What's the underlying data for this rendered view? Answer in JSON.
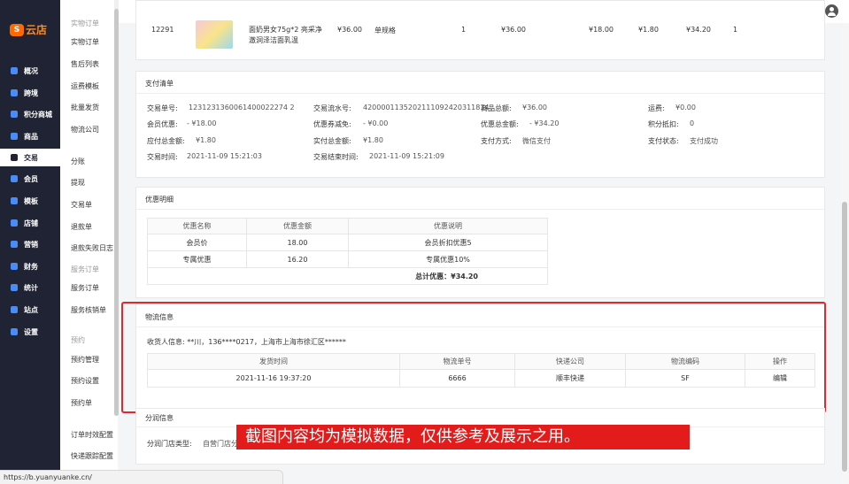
{
  "logo": {
    "mark": "S",
    "text": "云店"
  },
  "nav": [
    {
      "label": "概况",
      "active": false
    },
    {
      "label": "跨境",
      "active": false
    },
    {
      "label": "积分商城",
      "active": false
    },
    {
      "label": "商品",
      "active": false
    },
    {
      "label": "交易",
      "active": true
    },
    {
      "label": "会员",
      "active": false
    },
    {
      "label": "模板",
      "active": false
    },
    {
      "label": "店铺",
      "active": false
    },
    {
      "label": "营销",
      "active": false
    },
    {
      "label": "财务",
      "active": false
    },
    {
      "label": "统计",
      "active": false
    },
    {
      "label": "站点",
      "active": false
    },
    {
      "label": "设置",
      "active": false
    }
  ],
  "submenu": [
    {
      "label": "实物订单",
      "group": true
    },
    {
      "label": "实物订单",
      "group": false
    },
    {
      "label": "售后列表",
      "group": false
    },
    {
      "label": "运费模板",
      "group": false
    },
    {
      "label": "批量发货",
      "group": false
    },
    {
      "label": "物流公司",
      "group": false
    },
    {
      "label": "分账",
      "group": false
    },
    {
      "label": "提现",
      "group": false
    },
    {
      "label": "交易单",
      "group": false
    },
    {
      "label": "退款单",
      "group": false
    },
    {
      "label": "退款失败日志",
      "group": false
    },
    {
      "label": "服务订单",
      "group": true
    },
    {
      "label": "服务订单",
      "group": false
    },
    {
      "label": "服务核销单",
      "group": false
    },
    {
      "label": "预约",
      "group": true
    },
    {
      "label": "预约管理",
      "group": false
    },
    {
      "label": "预约设置",
      "group": false
    },
    {
      "label": "预约单",
      "group": false
    },
    {
      "label": "订单时效配置",
      "group": false
    },
    {
      "label": "快递跟踪配置",
      "group": false
    }
  ],
  "product_row": {
    "id": "12291",
    "name_line1": "面奶男女75g*2 亮采净",
    "name_line2": "澈洞泽洁面乳温",
    "price": "¥36.00",
    "spec": "单规格",
    "qty": "1",
    "total": "¥36.00",
    "paid": "¥18.00",
    "discount": "¥1.80",
    "final": "¥34.20",
    "num": "1"
  },
  "payment": {
    "title": "支付清单",
    "fields": [
      {
        "label": "交易单号:",
        "value": "1231231360061400022274 2"
      },
      {
        "label": "交易流水号:",
        "value": "4200001135202111092420311834"
      },
      {
        "label": "商品总额:",
        "value": "¥36.00"
      },
      {
        "label": "运费:",
        "value": "¥0.00"
      },
      {
        "label": "会员优惠:",
        "value": "- ¥18.00"
      },
      {
        "label": "优惠券减免:",
        "value": "- ¥0.00"
      },
      {
        "label": "优惠总金额:",
        "value": "- ¥34.20"
      },
      {
        "label": "积分抵扣:",
        "value": "0"
      },
      {
        "label": "应付总金额:",
        "value": "¥1.80"
      },
      {
        "label": "实付总金额:",
        "value": "¥1.80"
      },
      {
        "label": "支付方式:",
        "value": "微信支付"
      },
      {
        "label": "支付状态:",
        "value": "支付成功"
      },
      {
        "label": "交易时间:",
        "value": "2021-11-09 15:21:03"
      },
      {
        "label": "交易结束时间:",
        "value": "2021-11-09 15:21:09"
      }
    ]
  },
  "discount_detail": {
    "title": "优惠明细",
    "headers": [
      "优惠名称",
      "优惠金额",
      "优惠说明"
    ],
    "rows": [
      [
        "会员价",
        "18.00",
        "会员折扣优惠5"
      ],
      [
        "专属优惠",
        "16.20",
        "专属优惠10%"
      ]
    ],
    "total": "总计优惠：¥34.20"
  },
  "logistics": {
    "title": "物流信息",
    "receiver": "收货人信息: **川，136****0217，上海市上海市徐汇区******",
    "headers": [
      "发货时间",
      "物流单号",
      "快递公司",
      "物流编码",
      "操作"
    ],
    "row": [
      "2021-11-16 19:37:20",
      "6666",
      "顺丰快递",
      "SF",
      "编辑"
    ]
  },
  "store_info": {
    "title": "分润信息",
    "label": "分润门店类型:",
    "value": "自营门店分"
  },
  "watermark": "截图内容均为模拟数据，仅供参考及展示之用。",
  "status_url": "https://b.yuanyuanke.cn/"
}
